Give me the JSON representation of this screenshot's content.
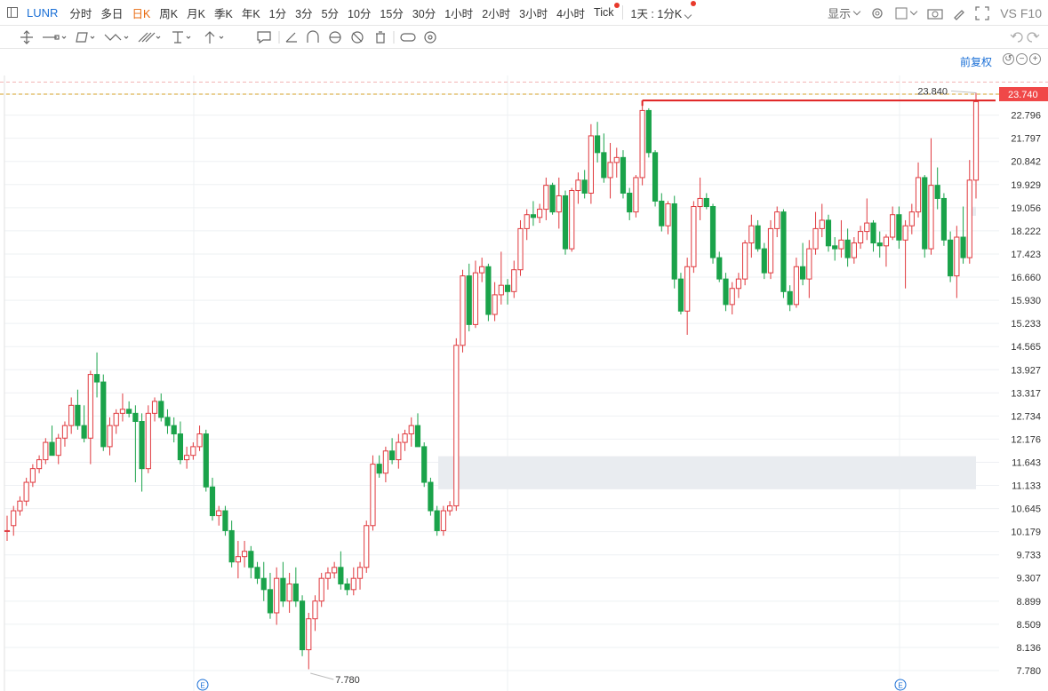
{
  "toolbar": {
    "symbol": "LUNR",
    "periods": [
      "分时",
      "多日",
      "日K",
      "周K",
      "月K",
      "季K",
      "年K",
      "1分",
      "3分",
      "5分",
      "10分",
      "15分",
      "30分",
      "1小时",
      "2小时",
      "3小时",
      "4小时",
      "Tick"
    ],
    "active_period": "日K",
    "dotted_period": "Tick",
    "range_label": "1天 : 1分K",
    "display_label": "显示",
    "vs_label": "VS",
    "f10_label": "F10"
  },
  "chart_header": {
    "adjust_label": "前复权"
  },
  "colors": {
    "up": "#e0393e",
    "down": "#1aa34a",
    "grid": "#eef0f3",
    "resistance": "#e02020",
    "last_price_bg": "#f04848",
    "prev_close_line": "#d4a02a",
    "high_line": "#f3b3b3"
  },
  "chart_data": {
    "type": "candlestick",
    "y_axis": {
      "ticks": [
        "23.740",
        "22.796",
        "21.797",
        "20.842",
        "19.929",
        "19.056",
        "18.222",
        "17.423",
        "16.660",
        "15.930",
        "15.233",
        "14.565",
        "13.927",
        "13.317",
        "12.734",
        "12.176",
        "11.643",
        "11.133",
        "10.645",
        "10.179",
        "9.733",
        "9.307",
        "8.899",
        "8.509",
        "8.136",
        "7.780"
      ],
      "scale": "log",
      "range": [
        7.78,
        24.3
      ]
    },
    "last_price": "23.740",
    "high_marker": "23.840",
    "low_marker": "7.780",
    "resistance_level": 23.45,
    "candles": [
      [
        10.2,
        10.5,
        10.0,
        10.2
      ],
      [
        10.3,
        10.7,
        10.1,
        10.6
      ],
      [
        10.6,
        10.9,
        10.5,
        10.8
      ],
      [
        10.8,
        11.3,
        10.7,
        11.2
      ],
      [
        11.2,
        11.6,
        11.1,
        11.5
      ],
      [
        11.5,
        11.8,
        11.4,
        11.7
      ],
      [
        11.7,
        12.2,
        11.6,
        12.1
      ],
      [
        12.1,
        12.5,
        11.9,
        11.8
      ],
      [
        11.8,
        12.3,
        11.6,
        12.2
      ],
      [
        12.2,
        12.6,
        12.0,
        12.5
      ],
      [
        12.5,
        13.2,
        12.3,
        13.0
      ],
      [
        13.0,
        13.4,
        12.4,
        12.5
      ],
      [
        12.5,
        13.0,
        12.1,
        12.2
      ],
      [
        12.2,
        13.9,
        11.6,
        13.8
      ],
      [
        13.8,
        14.4,
        13.2,
        13.6
      ],
      [
        13.6,
        13.8,
        11.9,
        12.0
      ],
      [
        12.0,
        12.7,
        11.8,
        12.5
      ],
      [
        12.5,
        12.9,
        12.3,
        12.8
      ],
      [
        12.8,
        13.3,
        12.6,
        12.9
      ],
      [
        12.9,
        13.1,
        12.7,
        12.8
      ],
      [
        12.8,
        13.0,
        11.2,
        12.6
      ],
      [
        12.6,
        12.8,
        11.0,
        11.5
      ],
      [
        11.5,
        13.0,
        11.4,
        12.8
      ],
      [
        12.8,
        13.2,
        12.6,
        13.1
      ],
      [
        13.1,
        13.3,
        12.6,
        12.7
      ],
      [
        12.7,
        12.9,
        12.3,
        12.5
      ],
      [
        12.5,
        12.7,
        12.1,
        12.3
      ],
      [
        12.3,
        12.6,
        11.6,
        11.7
      ],
      [
        11.7,
        12.0,
        11.5,
        11.8
      ],
      [
        11.8,
        12.1,
        11.7,
        12.0
      ],
      [
        12.0,
        12.5,
        11.9,
        12.3
      ],
      [
        12.3,
        12.4,
        11.0,
        11.1
      ],
      [
        11.1,
        11.3,
        10.4,
        10.5
      ],
      [
        10.5,
        10.7,
        10.3,
        10.6
      ],
      [
        10.6,
        10.7,
        10.1,
        10.2
      ],
      [
        10.2,
        10.4,
        9.5,
        9.6
      ],
      [
        9.6,
        10.0,
        9.3,
        9.7
      ],
      [
        9.7,
        10.0,
        9.5,
        9.8
      ],
      [
        9.8,
        9.9,
        9.3,
        9.5
      ],
      [
        9.5,
        9.6,
        9.2,
        9.3
      ],
      [
        9.3,
        9.6,
        8.9,
        9.1
      ],
      [
        9.1,
        9.4,
        8.6,
        8.7
      ],
      [
        8.7,
        9.5,
        8.5,
        9.3
      ],
      [
        9.3,
        9.6,
        8.8,
        8.9
      ],
      [
        8.9,
        9.4,
        8.7,
        9.2
      ],
      [
        9.2,
        9.5,
        8.8,
        8.9
      ],
      [
        8.9,
        9.0,
        8.0,
        8.1
      ],
      [
        8.1,
        8.7,
        7.8,
        8.6
      ],
      [
        8.6,
        9.0,
        8.4,
        8.9
      ],
      [
        8.9,
        9.4,
        8.8,
        9.3
      ],
      [
        9.3,
        9.5,
        9.1,
        9.4
      ],
      [
        9.4,
        9.6,
        9.3,
        9.5
      ],
      [
        9.5,
        9.8,
        9.1,
        9.2
      ],
      [
        9.2,
        9.3,
        9.0,
        9.1
      ],
      [
        9.1,
        9.5,
        9.0,
        9.3
      ],
      [
        9.3,
        9.6,
        9.1,
        9.5
      ],
      [
        9.5,
        10.4,
        9.4,
        10.3
      ],
      [
        10.3,
        11.8,
        10.2,
        11.6
      ],
      [
        11.6,
        11.8,
        11.3,
        11.4
      ],
      [
        11.4,
        12.0,
        11.2,
        11.9
      ],
      [
        11.9,
        12.2,
        11.6,
        11.7
      ],
      [
        11.7,
        12.3,
        11.5,
        12.1
      ],
      [
        12.1,
        12.4,
        11.9,
        12.3
      ],
      [
        12.3,
        12.7,
        12.0,
        12.5
      ],
      [
        12.5,
        12.8,
        12.1,
        12.0
      ],
      [
        12.0,
        12.1,
        11.1,
        11.2
      ],
      [
        11.2,
        11.3,
        10.5,
        10.6
      ],
      [
        10.6,
        10.7,
        10.1,
        10.2
      ],
      [
        10.2,
        10.7,
        10.1,
        10.6
      ],
      [
        10.6,
        10.8,
        10.5,
        10.7
      ],
      [
        10.7,
        14.8,
        10.6,
        14.6
      ],
      [
        14.6,
        16.9,
        14.4,
        16.7
      ],
      [
        16.7,
        17.1,
        15.0,
        15.2
      ],
      [
        15.2,
        17.2,
        15.1,
        16.8
      ],
      [
        16.8,
        17.3,
        16.5,
        17.0
      ],
      [
        17.0,
        17.1,
        15.3,
        15.5
      ],
      [
        15.5,
        16.5,
        15.3,
        16.1
      ],
      [
        16.1,
        17.5,
        15.8,
        16.4
      ],
      [
        16.4,
        16.6,
        15.8,
        16.2
      ],
      [
        16.2,
        17.2,
        16.0,
        16.9
      ],
      [
        16.9,
        18.6,
        16.7,
        18.3
      ],
      [
        18.3,
        19.0,
        17.9,
        18.8
      ],
      [
        18.8,
        19.3,
        18.4,
        18.7
      ],
      [
        18.7,
        19.2,
        18.5,
        19.0
      ],
      [
        19.0,
        20.2,
        18.6,
        19.9
      ],
      [
        19.9,
        20.0,
        18.8,
        18.9
      ],
      [
        18.9,
        20.2,
        18.3,
        19.5
      ],
      [
        19.5,
        19.7,
        17.4,
        17.6
      ],
      [
        17.6,
        19.8,
        17.5,
        19.7
      ],
      [
        19.7,
        20.4,
        19.2,
        20.1
      ],
      [
        20.1,
        20.5,
        19.4,
        19.6
      ],
      [
        19.6,
        22.4,
        19.2,
        21.9
      ],
      [
        21.9,
        22.5,
        20.8,
        21.2
      ],
      [
        21.2,
        22.0,
        20.0,
        20.2
      ],
      [
        20.2,
        21.6,
        19.4,
        20.8
      ],
      [
        20.8,
        21.4,
        20.2,
        21.0
      ],
      [
        21.0,
        21.3,
        19.4,
        19.6
      ],
      [
        19.6,
        19.8,
        18.6,
        18.9
      ],
      [
        18.9,
        20.3,
        18.7,
        20.2
      ],
      [
        20.2,
        23.4,
        19.9,
        23.0
      ],
      [
        23.0,
        23.1,
        21.0,
        21.2
      ],
      [
        21.2,
        21.3,
        19.1,
        19.3
      ],
      [
        19.3,
        19.6,
        18.2,
        18.4
      ],
      [
        18.4,
        19.3,
        18.1,
        19.2
      ],
      [
        19.2,
        19.5,
        16.3,
        16.6
      ],
      [
        16.6,
        16.8,
        15.5,
        15.6
      ],
      [
        15.6,
        17.3,
        14.9,
        17.0
      ],
      [
        17.0,
        19.3,
        16.8,
        19.1
      ],
      [
        19.1,
        20.2,
        18.6,
        19.4
      ],
      [
        19.4,
        19.6,
        19.0,
        19.1
      ],
      [
        19.1,
        19.2,
        17.1,
        17.3
      ],
      [
        17.3,
        17.5,
        16.5,
        16.6
      ],
      [
        16.6,
        16.8,
        15.6,
        15.8
      ],
      [
        15.8,
        16.5,
        15.5,
        16.3
      ],
      [
        16.3,
        16.8,
        16.0,
        16.6
      ],
      [
        16.6,
        17.9,
        16.4,
        17.8
      ],
      [
        17.8,
        18.8,
        17.3,
        18.4
      ],
      [
        18.4,
        18.6,
        17.5,
        17.6
      ],
      [
        17.6,
        17.8,
        16.6,
        16.8
      ],
      [
        16.8,
        18.6,
        16.6,
        18.3
      ],
      [
        18.3,
        19.1,
        18.0,
        18.9
      ],
      [
        18.9,
        19.0,
        16.0,
        16.2
      ],
      [
        16.2,
        16.4,
        15.6,
        15.8
      ],
      [
        15.8,
        17.3,
        15.7,
        17.0
      ],
      [
        17.0,
        17.8,
        16.4,
        16.6
      ],
      [
        16.6,
        17.9,
        16.0,
        17.6
      ],
      [
        17.6,
        18.9,
        17.4,
        18.3
      ],
      [
        18.3,
        19.2,
        18.0,
        18.6
      ],
      [
        18.6,
        18.8,
        17.5,
        17.7
      ],
      [
        17.7,
        18.0,
        17.2,
        17.6
      ],
      [
        17.6,
        18.6,
        17.3,
        17.9
      ],
      [
        17.9,
        18.3,
        17.0,
        17.3
      ],
      [
        17.3,
        18.0,
        17.1,
        17.8
      ],
      [
        17.8,
        18.4,
        17.6,
        18.2
      ],
      [
        18.2,
        19.4,
        17.9,
        18.5
      ],
      [
        18.5,
        18.6,
        17.5,
        17.8
      ],
      [
        17.8,
        18.2,
        17.3,
        17.7
      ],
      [
        17.7,
        18.1,
        17.0,
        18.0
      ],
      [
        18.0,
        19.1,
        17.9,
        18.8
      ],
      [
        18.8,
        19.1,
        17.6,
        17.9
      ],
      [
        17.9,
        18.6,
        16.3,
        18.4
      ],
      [
        18.4,
        19.2,
        18.1,
        18.9
      ],
      [
        18.9,
        20.8,
        18.7,
        20.2
      ],
      [
        20.2,
        20.3,
        17.3,
        17.6
      ],
      [
        17.6,
        21.8,
        17.4,
        19.9
      ],
      [
        19.9,
        20.6,
        19.0,
        19.4
      ],
      [
        19.4,
        19.6,
        17.7,
        17.9
      ],
      [
        17.9,
        18.2,
        16.5,
        16.7
      ],
      [
        16.7,
        18.4,
        16.0,
        18.0
      ],
      [
        18.0,
        19.1,
        17.1,
        17.3
      ],
      [
        17.3,
        20.9,
        17.1,
        20.1
      ],
      [
        20.1,
        23.8,
        19.4,
        23.4
      ]
    ]
  }
}
